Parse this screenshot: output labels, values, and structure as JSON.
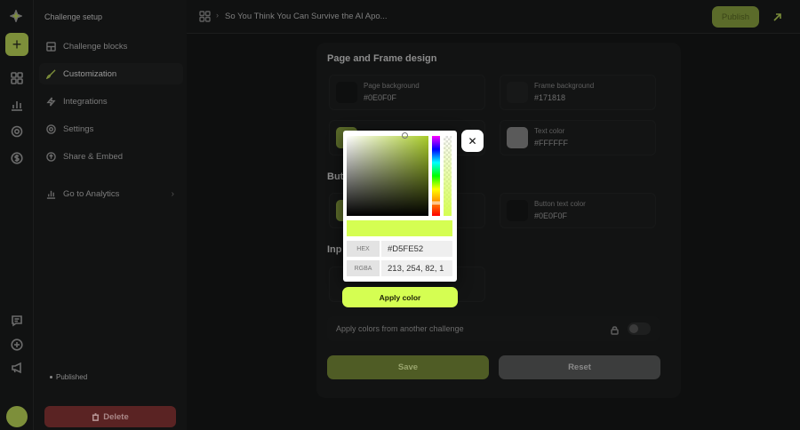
{
  "rail": {
    "icons": [
      "logo-icon",
      "add-icon",
      "grid-icon",
      "chart-icon",
      "gear-icon",
      "dollar-icon",
      "chat-icon",
      "plus-circle-icon",
      "megaphone-icon"
    ]
  },
  "sidebar": {
    "title": "Challenge setup",
    "items": [
      {
        "label": "Challenge blocks",
        "icon": "blocks-icon"
      },
      {
        "label": "Customization",
        "icon": "brush-icon",
        "active": true
      },
      {
        "label": "Integrations",
        "icon": "bolt-icon"
      },
      {
        "label": "Settings",
        "icon": "gear-icon"
      },
      {
        "label": "Share & Embed",
        "icon": "share-icon"
      },
      {
        "label": "Go to Analytics",
        "icon": "chart-icon"
      }
    ],
    "status": "Published",
    "delete_label": "Delete"
  },
  "topbar": {
    "separator": "›",
    "title": "So You Think You Can Survive the AI Apo...",
    "publish_label": "Publish"
  },
  "main": {
    "section_page_frame": "Page and Frame design",
    "section_buttons": "Butt",
    "section_inputs": "Inp",
    "cards": {
      "page_bg": {
        "label": "Page background",
        "value": "#0E0F0F",
        "color": "#0E0F0F"
      },
      "frame_bg": {
        "label": "Frame background",
        "value": "#171818",
        "color": "#171818"
      },
      "accent": {
        "label": "",
        "value": "",
        "color": "#5b6b2a"
      },
      "text_color": {
        "label": "Text color",
        "value": "#FFFFFF",
        "color": "#5a5a5a"
      },
      "button_bg": {
        "label": "",
        "value": "",
        "color": "#5b6b2a"
      },
      "button_text": {
        "label": "Button text color",
        "value": "#0E0F0F",
        "color": "#0E0F0F"
      }
    },
    "apply_colors_label": "Apply colors from another challenge",
    "save_label": "Save",
    "reset_label": "Reset"
  },
  "picker": {
    "selected_color": "#d5fe52",
    "hex_label": "HEX",
    "hex_value": "#D5FE52",
    "rgba_label": "RGBA",
    "rgba_value": "213, 254, 82, 1",
    "apply_label": "Apply color",
    "close_symbol": "✕"
  }
}
